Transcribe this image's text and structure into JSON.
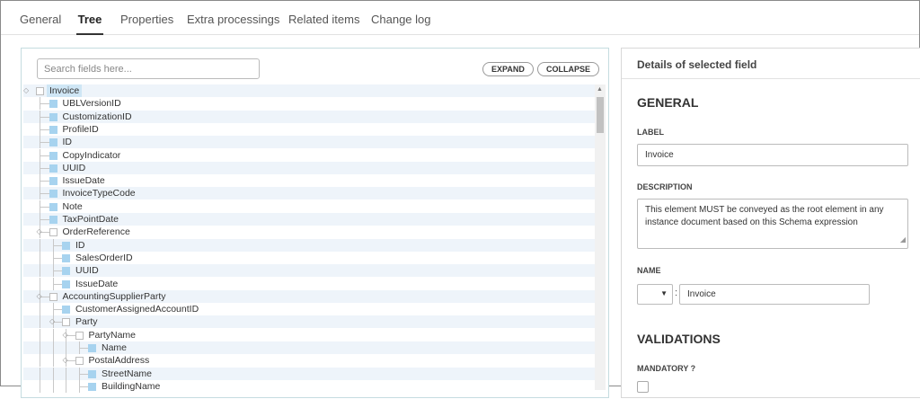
{
  "tabs": [
    {
      "label": "General",
      "active": false
    },
    {
      "label": "Tree",
      "active": true
    },
    {
      "label": "Properties",
      "active": false
    },
    {
      "label": "Extra processings",
      "active": false
    },
    {
      "label": "Related items",
      "active": false
    },
    {
      "label": "Change log",
      "active": false
    }
  ],
  "tree_panel": {
    "search_placeholder": "Search fields here...",
    "expand_label": "EXPAND",
    "collapse_label": "COLLAPSE",
    "nodes": [
      {
        "label": "Invoice",
        "level": 0,
        "type": "group",
        "selected": true
      },
      {
        "label": "UBLVersionID",
        "level": 1,
        "type": "leaf"
      },
      {
        "label": "CustomizationID",
        "level": 1,
        "type": "leaf"
      },
      {
        "label": "ProfileID",
        "level": 1,
        "type": "leaf"
      },
      {
        "label": "ID",
        "level": 1,
        "type": "leaf"
      },
      {
        "label": "CopyIndicator",
        "level": 1,
        "type": "leaf"
      },
      {
        "label": "UUID",
        "level": 1,
        "type": "leaf"
      },
      {
        "label": "IssueDate",
        "level": 1,
        "type": "leaf"
      },
      {
        "label": "InvoiceTypeCode",
        "level": 1,
        "type": "leaf"
      },
      {
        "label": "Note",
        "level": 1,
        "type": "leaf"
      },
      {
        "label": "TaxPointDate",
        "level": 1,
        "type": "leaf"
      },
      {
        "label": "OrderReference",
        "level": 1,
        "type": "group"
      },
      {
        "label": "ID",
        "level": 2,
        "type": "leaf"
      },
      {
        "label": "SalesOrderID",
        "level": 2,
        "type": "leaf"
      },
      {
        "label": "UUID",
        "level": 2,
        "type": "leaf"
      },
      {
        "label": "IssueDate",
        "level": 2,
        "type": "leaf"
      },
      {
        "label": "AccountingSupplierParty",
        "level": 1,
        "type": "group"
      },
      {
        "label": "CustomerAssignedAccountID",
        "level": 2,
        "type": "leaf"
      },
      {
        "label": "Party",
        "level": 2,
        "type": "group"
      },
      {
        "label": "PartyName",
        "level": 3,
        "type": "group"
      },
      {
        "label": "Name",
        "level": 4,
        "type": "leaf"
      },
      {
        "label": "PostalAddress",
        "level": 3,
        "type": "group"
      },
      {
        "label": "StreetName",
        "level": 4,
        "type": "leaf"
      },
      {
        "label": "BuildingName",
        "level": 4,
        "type": "leaf"
      }
    ]
  },
  "details_panel": {
    "header": "Details of selected field",
    "general_title": "GENERAL",
    "label_caption": "LABEL",
    "label_value": "Invoice",
    "description_caption": "DESCRIPTION",
    "description_value": "This element MUST be conveyed as the root element in any instance document based on this Schema expression",
    "name_caption": "NAME",
    "name_prefix_value": "",
    "name_separator": ":",
    "name_value": "Invoice",
    "validations_title": "VALIDATIONS",
    "mandatory_caption": "MANDATORY ?",
    "mandatory_checked": false
  },
  "colors": {
    "leaf_square": "#a7d3ef",
    "selected_bg": "#cfe6f5",
    "row_alt_bg": "#eef4fa",
    "panel_border": "#c5dce0"
  }
}
